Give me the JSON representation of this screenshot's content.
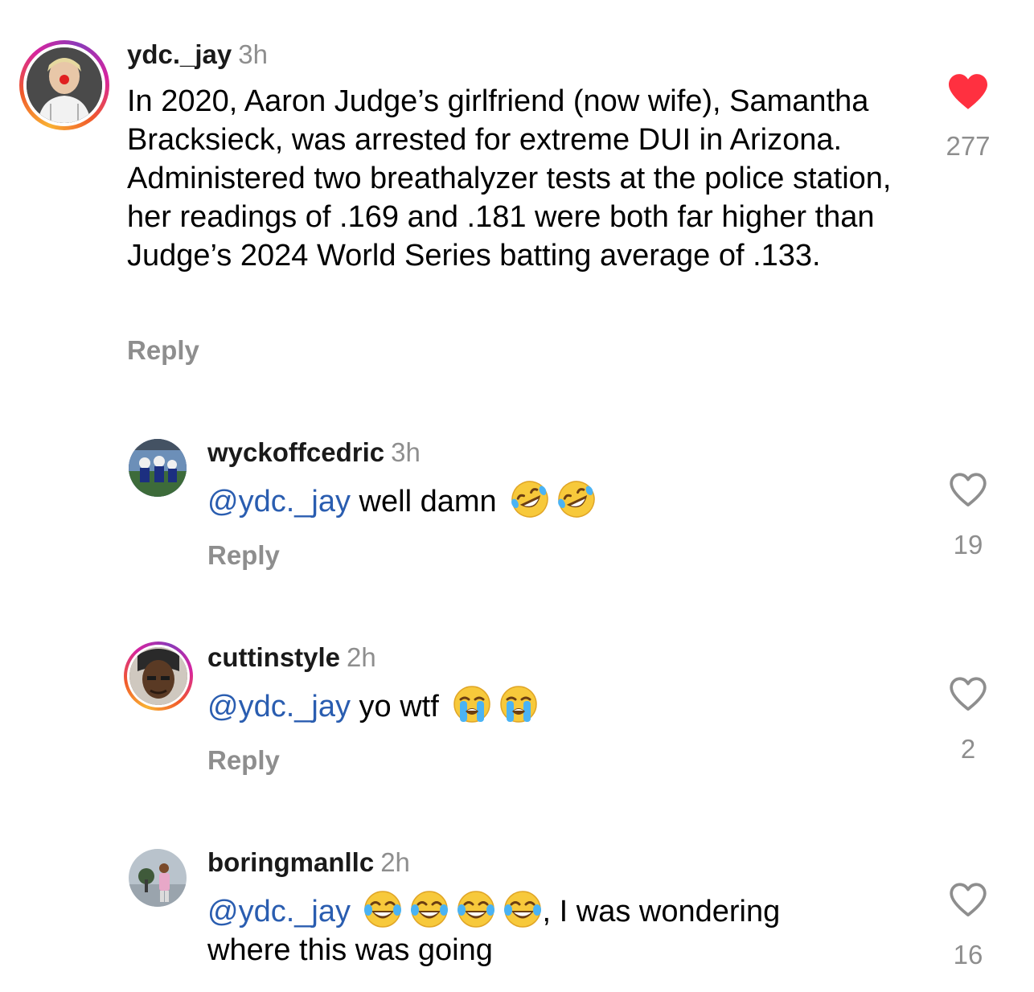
{
  "comments": [
    {
      "username": "ydc._jay",
      "time": "3h",
      "text": "In 2020, Aaron Judge’s girlfriend (now wife), Samantha Bracksieck, was arrested for extreme DUI in Arizona. Administered two breathalyzer tests at the police station, her readings of .169 and .181 were both far higher than Judge’s 2024 World Series batting average of .133.",
      "reply_label": "Reply",
      "likes": "277",
      "liked": true,
      "like_color": "#ff3040"
    },
    {
      "username": "wyckoffcedric",
      "time": "3h",
      "mention": "@ydc._jay",
      "text": "well damn",
      "emoji_name": "rolling-on-floor-laughing-emoji",
      "reply_label": "Reply",
      "likes": "19",
      "liked": false
    },
    {
      "username": "cuttinstyle",
      "time": "2h",
      "mention": "@ydc._jay",
      "text": "yo wtf",
      "emoji_name": "loudly-crying-face-emoji",
      "reply_label": "Reply",
      "likes": "2",
      "liked": false
    },
    {
      "username": "boringmanllc",
      "time": "2h",
      "mention": "@ydc._jay",
      "text_after_emoji": ", I was wondering",
      "text_line2": "where this was going",
      "emoji_name": "face-with-tears-of-joy-emoji",
      "reply_label": "",
      "likes": "16",
      "liked": false
    }
  ],
  "colors": {
    "mention": "#2a5db0",
    "secondary_text": "#8e8e8e",
    "like_active": "#ff3040"
  }
}
